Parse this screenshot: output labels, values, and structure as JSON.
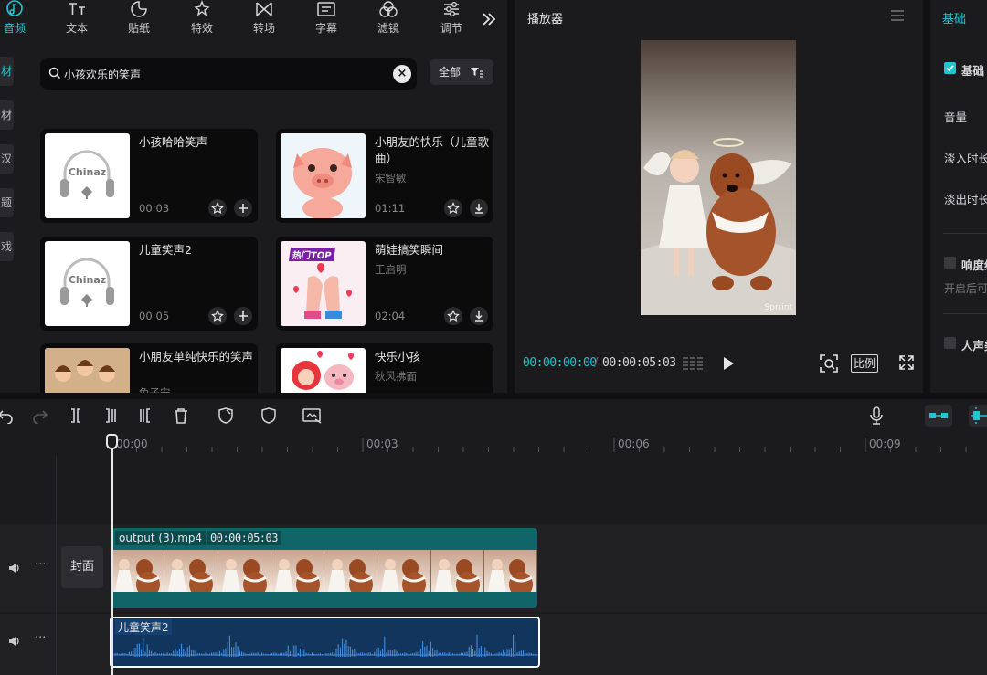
{
  "media_tabs": [
    {
      "label": "音频",
      "icon": "music-note-icon",
      "active": true
    },
    {
      "label": "文本",
      "icon": "text-icon",
      "active": false
    },
    {
      "label": "贴纸",
      "icon": "sticker-icon",
      "active": false
    },
    {
      "label": "特效",
      "icon": "effects-icon",
      "active": false
    },
    {
      "label": "转场",
      "icon": "transition-icon",
      "active": false
    },
    {
      "label": "字幕",
      "icon": "caption-icon",
      "active": false
    },
    {
      "label": "滤镜",
      "icon": "filter-icon",
      "active": false
    },
    {
      "label": "调节",
      "icon": "adjust-icon",
      "active": false
    }
  ],
  "more_tabs_icon": "double-chevron-right-icon",
  "left_rail": [
    "材",
    "材",
    "汉",
    "题",
    "戏"
  ],
  "search": {
    "value": "小孩欢乐的笑声"
  },
  "filter": {
    "label": "全部"
  },
  "audio_results": [
    {
      "title": "小孩哈哈笑声",
      "artist": "",
      "duration": "00:03",
      "thumb": "chinaz-headphones",
      "action": "add"
    },
    {
      "title": "小朋友的快乐（儿童歌曲）",
      "artist": "宋智敏",
      "duration": "01:11",
      "thumb": "pink-pig",
      "action": "download"
    },
    {
      "title": "儿童笑声2",
      "artist": "",
      "duration": "00:05",
      "thumb": "chinaz-headphones",
      "action": "add"
    },
    {
      "title": "萌娃搞笑瞬间",
      "artist": "王启明",
      "duration": "02:04",
      "thumb": "hot-top-clapping",
      "thumb_text": "热门TOP",
      "action": "download"
    },
    {
      "title": "小朋友单纯快乐的笑声",
      "artist": "兔子安",
      "duration": "",
      "thumb": "cartoon-kids",
      "action": ""
    },
    {
      "title": "快乐小孩",
      "artist": "秋风拂面",
      "duration": "",
      "thumb": "cartoon-pig-hearts",
      "action": ""
    }
  ],
  "chinaz_logo": "Chinaz",
  "player": {
    "title": "播放器",
    "current_time": "00:00:00:00",
    "separator": "/",
    "total_time": "00:00:05:03",
    "ratio_label": "比例",
    "preview_watermark": "Sprrint"
  },
  "properties": {
    "tab": "基础",
    "basic_section": "基础",
    "volume": "音量",
    "fade_in": "淡入时长",
    "fade_out": "淡出时长",
    "loudness": "响度统一",
    "loudness_hint": "开启后可",
    "vocal": "人声美化"
  },
  "timeline": {
    "ruler": [
      "00:00",
      "00:03",
      "00:06",
      "00:09"
    ],
    "cover_label": "封面",
    "video_clip": {
      "name": "output (3).mp4",
      "duration": "00:00:05:03"
    },
    "audio_clip": {
      "name": "儿童笑声2"
    }
  },
  "colors": {
    "accent": "#20c5d0",
    "panel": "#1b1b1e",
    "video_clip": "#0f6568",
    "audio_clip": "#12355e"
  }
}
